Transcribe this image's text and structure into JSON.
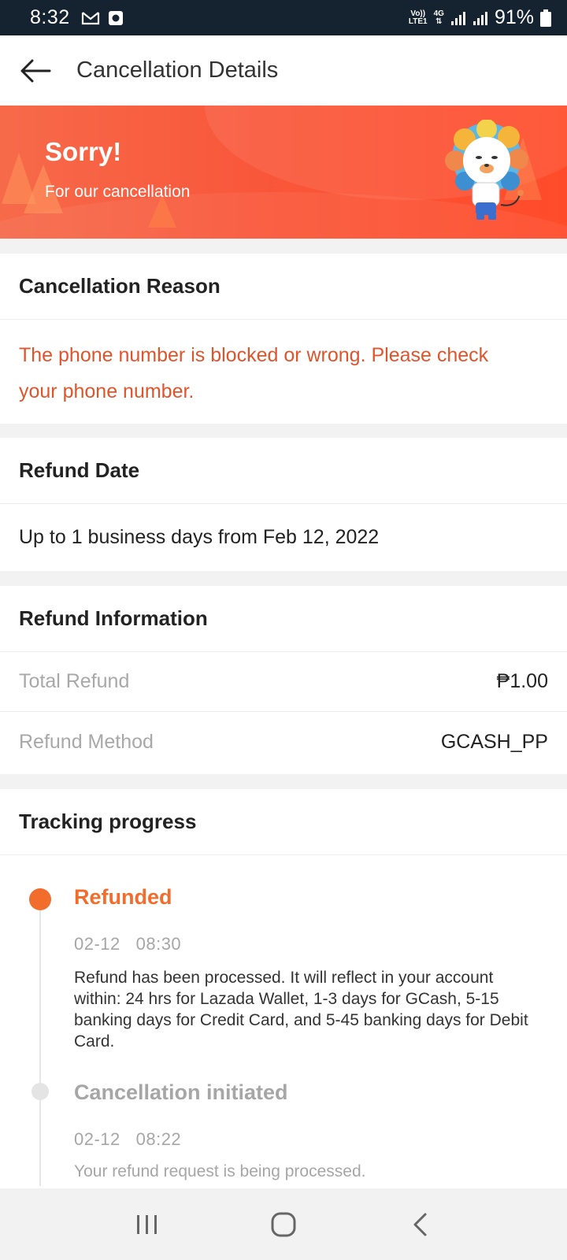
{
  "status_bar": {
    "time": "8:32",
    "notifications": [
      "gmail-icon",
      "camera-icon"
    ],
    "net_top": "Vo))",
    "net_bottom": "LTE1",
    "net_4g": "4G",
    "battery": "91%"
  },
  "app_bar": {
    "title": "Cancellation Details"
  },
  "banner": {
    "title": "Sorry!",
    "subtitle": "For our cancellation"
  },
  "cancellation_reason": {
    "header": "Cancellation Reason",
    "text": "The phone number is blocked or wrong. Please check your phone number."
  },
  "refund_date": {
    "header": "Refund Date",
    "text": "Up to 1 business days from Feb 12, 2022"
  },
  "refund_info": {
    "header": "Refund Information",
    "rows": [
      {
        "label": "Total Refund",
        "value": "₱1.00"
      },
      {
        "label": "Refund Method",
        "value": "GCASH_PP"
      }
    ]
  },
  "tracking": {
    "header": "Tracking progress",
    "steps": [
      {
        "title": "Refunded",
        "time": "02-12   08:30",
        "desc": "Refund has been processed. It will reflect in your account within: 24 hrs for Lazada Wallet, 1-3 days for GCash, 5-15 banking days for Credit Card, and 5-45 banking days for Debit Card."
      },
      {
        "title": "Cancellation initiated",
        "time": "02-12   08:22",
        "desc": "Your refund request is being processed."
      }
    ]
  },
  "colors": {
    "accent": "#f26d2b",
    "reason_text": "#e0542b",
    "banner": "#f9573a",
    "status_bar": "#14232f"
  }
}
